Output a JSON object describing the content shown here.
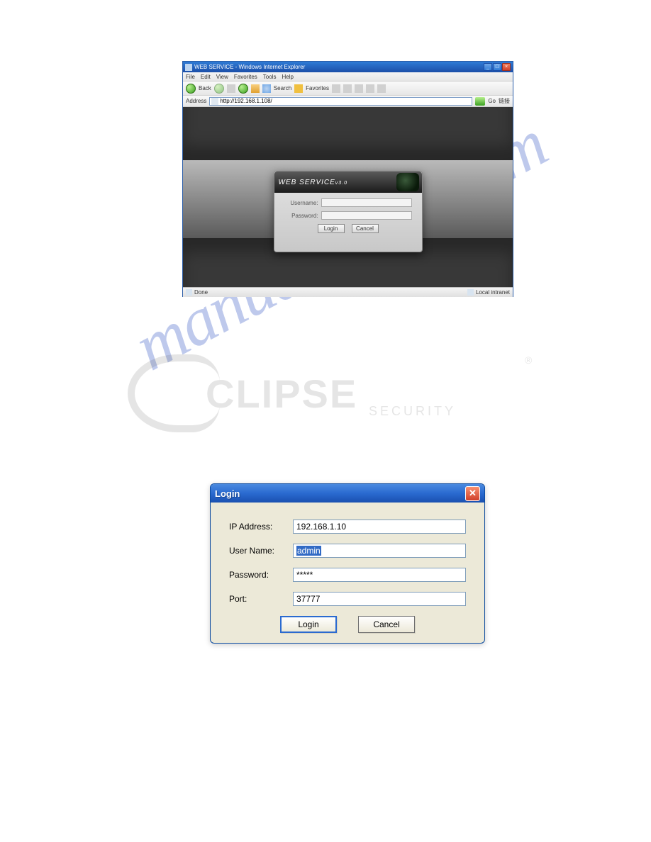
{
  "ie": {
    "title": "WEB SERVICE - Windows Internet Explorer",
    "menu": {
      "file": "File",
      "edit": "Edit",
      "view": "View",
      "favorites": "Favorites",
      "tools": "Tools",
      "help": "Help"
    },
    "toolbar": {
      "back": "Back",
      "search": "Search",
      "favorites": "Favorites"
    },
    "address": {
      "label": "Address",
      "value": "http://192.168.1.108/",
      "go": "Go",
      "links": "链接"
    },
    "status": {
      "done": "Done",
      "zone": "Local intranet"
    }
  },
  "webservice": {
    "brand_main": "WEB  SERVICE",
    "brand_sub": "v3.0",
    "username_label": "Username:",
    "password_label": "Password:",
    "login_btn": "Login",
    "cancel_btn": "Cancel"
  },
  "eclipse": {
    "brand": "CLIPSE",
    "sub": "SECURITY"
  },
  "watermark": "manualshive.com",
  "dialog": {
    "title": "Login",
    "ip_label": "IP Address:",
    "ip_value": "192.168.1.10",
    "user_label": "User Name:",
    "user_value": "admin",
    "pass_label": "Password:",
    "pass_value": "*****",
    "port_label": "Port:",
    "port_value": "37777",
    "login_btn": "Login",
    "cancel_btn": "Cancel"
  }
}
